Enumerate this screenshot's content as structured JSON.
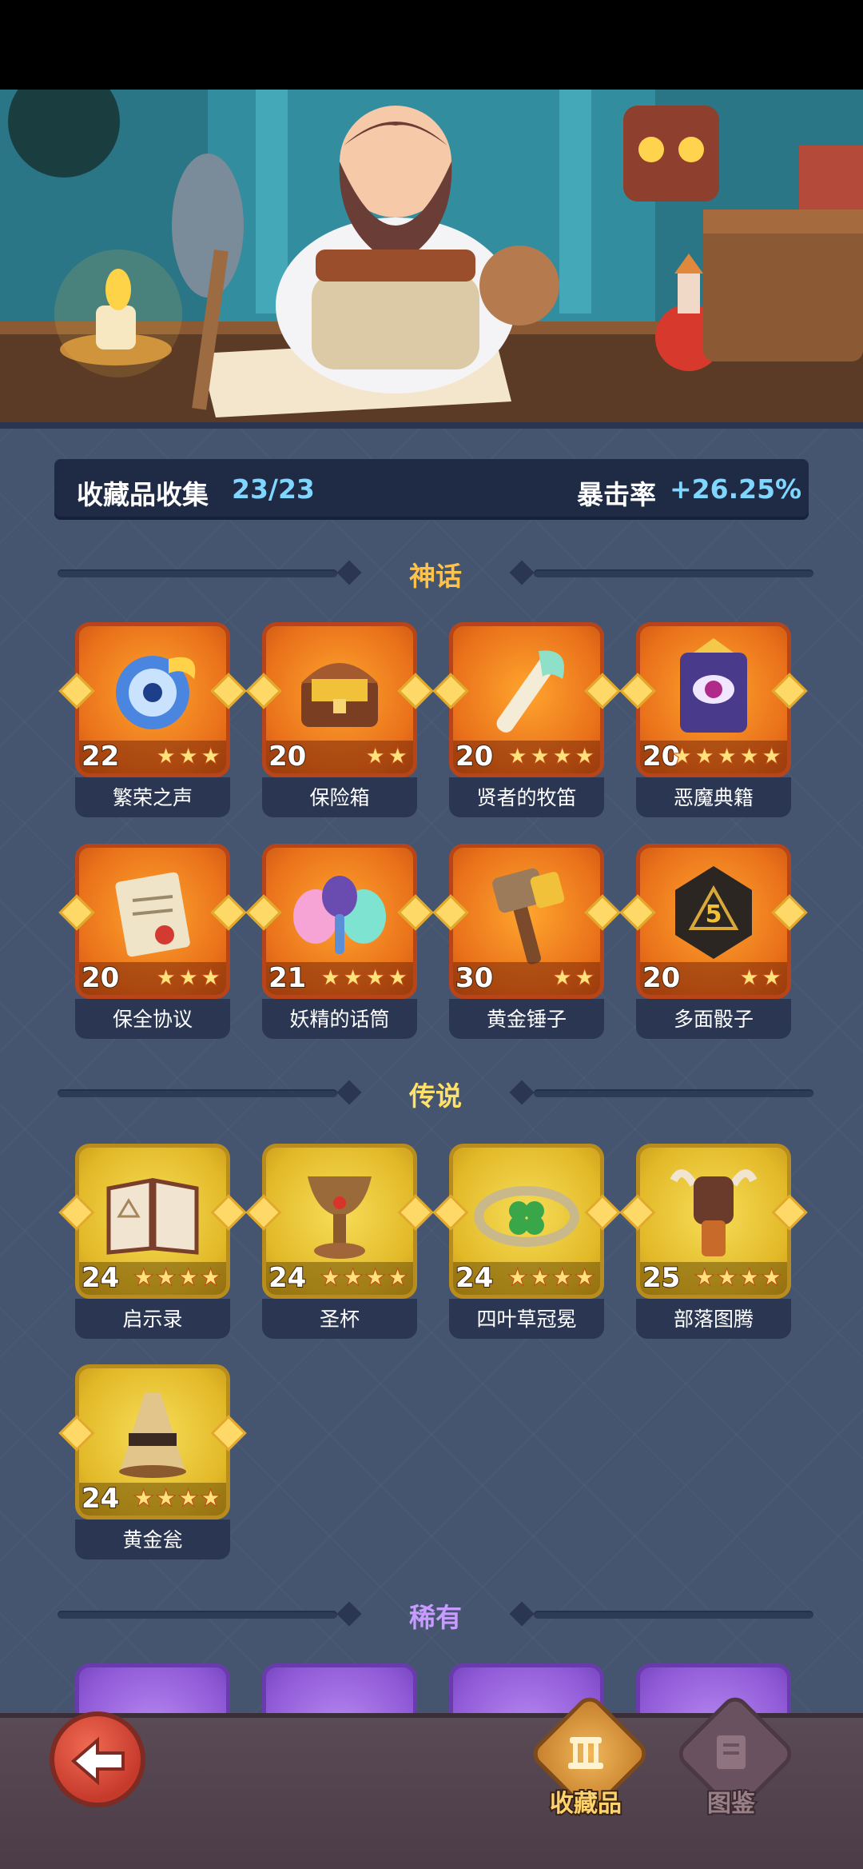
{
  "summary": {
    "collection_label": "收藏品收集",
    "collection_count": "23/23",
    "crit_label": "暴击率",
    "crit_value": "+26.25%"
  },
  "sections": [
    {
      "title": "神话",
      "color": "#ffc24a",
      "items": [
        {
          "name": "繁荣之声",
          "level": "22",
          "stars": 3,
          "icon": "horn-icon"
        },
        {
          "name": "保险箱",
          "level": "20",
          "stars": 2,
          "icon": "treasure-chest-icon"
        },
        {
          "name": "贤者的牧笛",
          "level": "20",
          "stars": 4,
          "icon": "flute-icon"
        },
        {
          "name": "恶魔典籍",
          "level": "20",
          "stars": 5,
          "icon": "demon-tome-icon"
        },
        {
          "name": "保全协议",
          "level": "20",
          "stars": 3,
          "icon": "contract-icon"
        },
        {
          "name": "妖精的话筒",
          "level": "21",
          "stars": 4,
          "icon": "fairy-microphone-icon"
        },
        {
          "name": "黄金锤子",
          "level": "30",
          "stars": 2,
          "icon": "golden-hammer-icon"
        },
        {
          "name": "多面骰子",
          "level": "20",
          "stars": 2,
          "icon": "dice-icon"
        }
      ]
    },
    {
      "title": "传说",
      "color": "#ffe16a",
      "items": [
        {
          "name": "启示录",
          "level": "24",
          "stars": 4,
          "icon": "book-icon"
        },
        {
          "name": "圣杯",
          "level": "24",
          "stars": 4,
          "icon": "grail-icon"
        },
        {
          "name": "四叶草冠冕",
          "level": "24",
          "stars": 4,
          "icon": "clover-crown-icon"
        },
        {
          "name": "部落图腾",
          "level": "25",
          "stars": 4,
          "icon": "totem-icon"
        },
        {
          "name": "黄金瓮",
          "level": "24",
          "stars": 4,
          "icon": "golden-urn-icon"
        }
      ]
    },
    {
      "title": "稀有",
      "color": "#c79bff"
    }
  ],
  "nav": {
    "collection_label": "收藏品",
    "codex_label": "图鉴"
  }
}
